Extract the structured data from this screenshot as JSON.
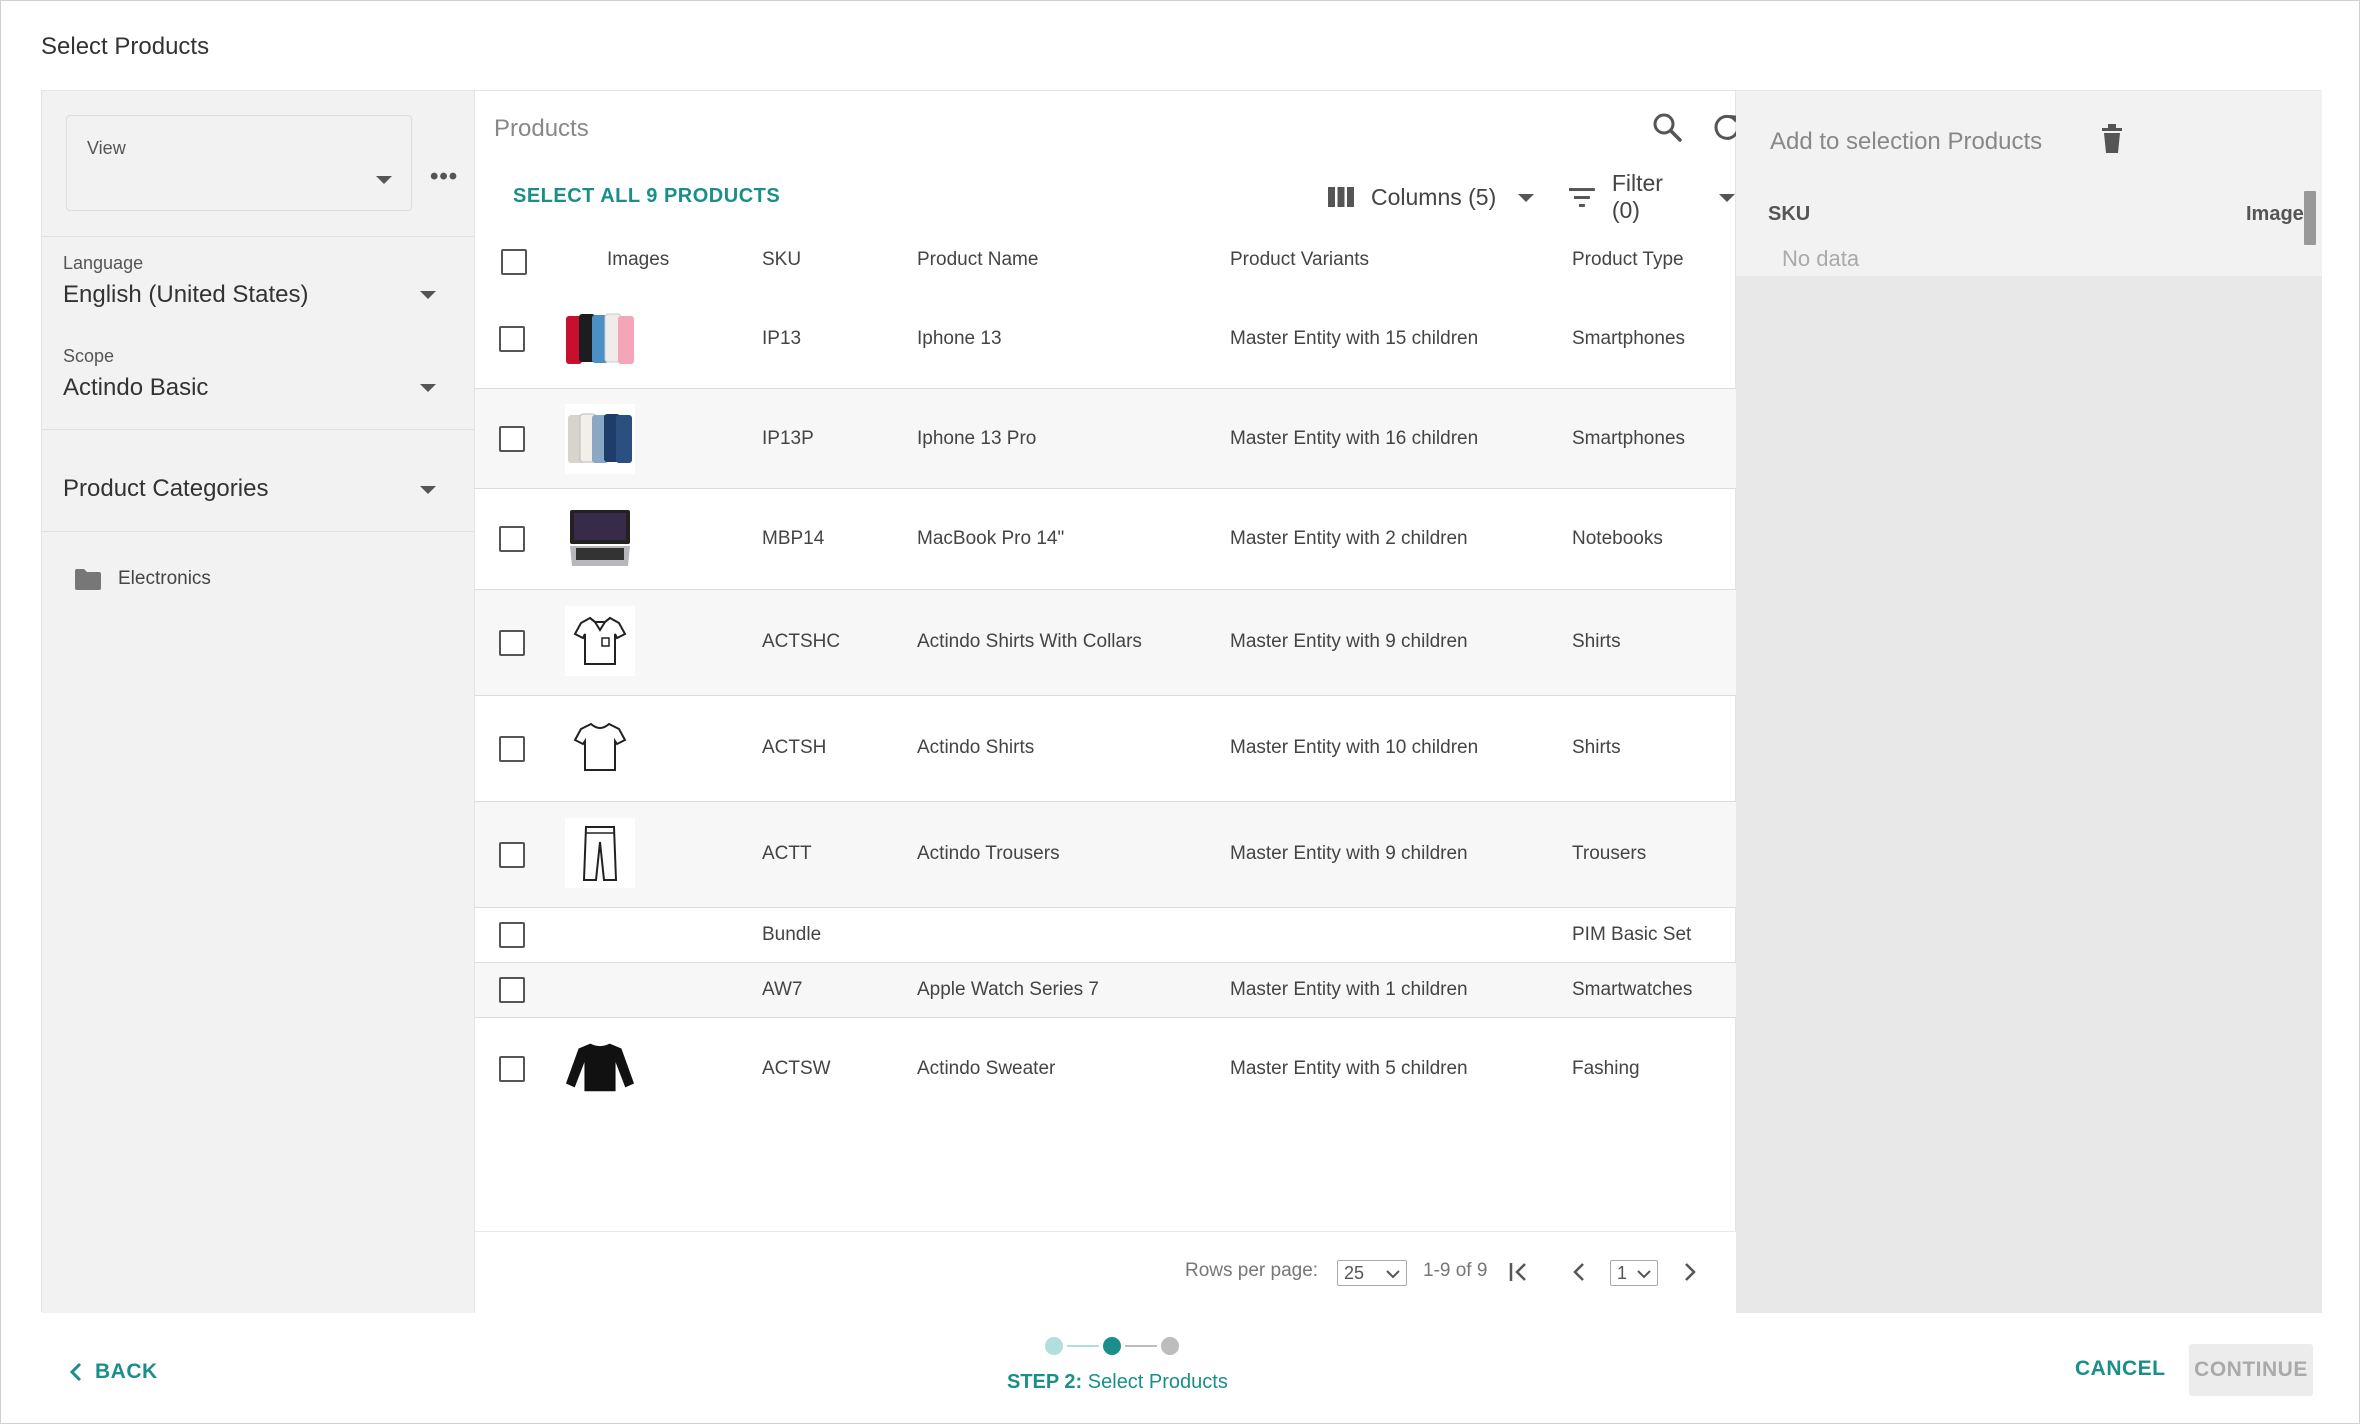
{
  "dialog": {
    "title": "Select Products"
  },
  "left_panel": {
    "view": {
      "label": "View",
      "value": ""
    },
    "language": {
      "label": "Language",
      "value": "English (United States)"
    },
    "scope": {
      "label": "Scope",
      "value": "Actindo Basic"
    },
    "categories": {
      "title": "Product Categories",
      "items": [
        {
          "label": "Electronics",
          "icon": "folder-icon"
        }
      ]
    }
  },
  "products": {
    "title": "Products",
    "select_all_label": "SELECT ALL 9 PRODUCTS",
    "columns_label": "Columns (5)",
    "filter_label": "Filter (0)",
    "headers": {
      "images": "Images",
      "sku": "SKU",
      "name": "Product Name",
      "variants": "Product Variants",
      "type": "Product Type"
    },
    "rows": [
      {
        "sku": "IP13",
        "name": "Iphone 13",
        "variants": "Master Entity with 15 children",
        "type": "Smartphones",
        "image": "iphone-13-thumbnail"
      },
      {
        "sku": "IP13P",
        "name": "Iphone 13 Pro",
        "variants": "Master Entity with 16 children",
        "type": "Smartphones",
        "image": "iphone-13-pro-thumbnail"
      },
      {
        "sku": "MBP14",
        "name": "MacBook Pro 14\"",
        "variants": "Master Entity with 2 children",
        "type": "Notebooks",
        "image": "macbook-thumbnail"
      },
      {
        "sku": "ACTSHC",
        "name": "Actindo Shirts With Collars",
        "variants": "Master Entity with 9 children",
        "type": "Shirts",
        "image": "collar-shirt-thumbnail"
      },
      {
        "sku": "ACTSH",
        "name": "Actindo Shirts",
        "variants": "Master Entity with 10 children",
        "type": "Shirts",
        "image": "tshirt-thumbnail"
      },
      {
        "sku": "ACTT",
        "name": "Actindo Trousers",
        "variants": "Master Entity with 9 children",
        "type": "Trousers",
        "image": "trousers-thumbnail"
      },
      {
        "sku": "Bundle",
        "name": "",
        "variants": "",
        "type": "PIM Basic Set",
        "image": ""
      },
      {
        "sku": "AW7",
        "name": "Apple Watch Series 7",
        "variants": "Master Entity with 1 children",
        "type": "Smartwatches",
        "image": ""
      },
      {
        "sku": "ACTSW",
        "name": "Actindo Sweater",
        "variants": "Master Entity with 5 children",
        "type": "Fashing",
        "image": "sweater-thumbnail"
      }
    ],
    "pagination": {
      "rows_per_page_label": "Rows per page:",
      "rows_per_page": "25",
      "range": "1-9 of 9",
      "page": "1"
    }
  },
  "selection": {
    "title": "Add to selection Products",
    "headers": {
      "sku": "SKU",
      "images": "Images"
    },
    "empty_text": "No data"
  },
  "footer": {
    "back_label": "BACK",
    "step_prefix": "STEP 2:",
    "step_name": "Select Products",
    "cancel_label": "CANCEL",
    "continue_label": "CONTINUE",
    "steps_total": 3,
    "current_step": 2
  },
  "colors": {
    "accent": "#1a8f8a",
    "step_inactive": "#b2dfdb",
    "step_future": "#bdbdbd"
  }
}
